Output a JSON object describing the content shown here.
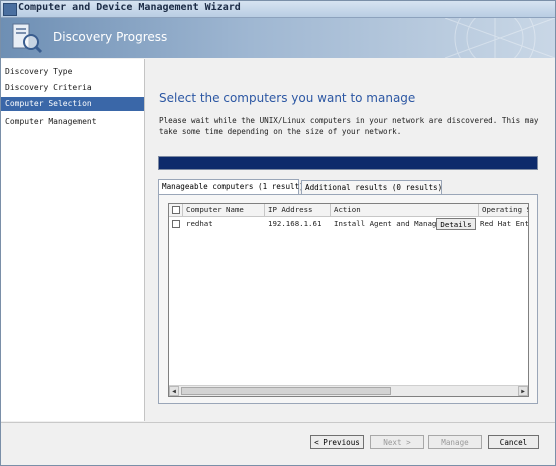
{
  "window": {
    "title": "Computer and Device Management Wizard"
  },
  "header": {
    "title": "Discovery Progress"
  },
  "nav": {
    "items": [
      {
        "label": "Discovery Type"
      },
      {
        "label": "Discovery Criteria"
      },
      {
        "label": "Computer Selection",
        "selected": true
      },
      {
        "label": "Computer Management"
      }
    ]
  },
  "main": {
    "heading": "Select the computers you want to manage",
    "description": "Please wait while the UNIX/Linux computers in your network are discovered. This may take some time depending on the size of your network.",
    "progress": 1.0,
    "tabs": [
      {
        "label": "Manageable computers (1 result)",
        "active": true
      },
      {
        "label": "Additional results (0 results)",
        "active": false
      }
    ],
    "grid": {
      "columns": [
        "Computer Name",
        "IP Address",
        "Action",
        "Operating S"
      ],
      "rows": [
        {
          "name": "redhat",
          "ip": "192.168.1.61",
          "action": "Install Agent and Manage",
          "details_label": "Details",
          "os": "Red Hat Ent"
        }
      ]
    }
  },
  "footer": {
    "previous_label": "< Previous",
    "next_label": "Next >",
    "manage_label": "Manage",
    "cancel_label": "Cancel"
  },
  "colors": {
    "accent": "#2c57a3",
    "selection": "#3a67a8",
    "progress": "#0d2a6b"
  }
}
